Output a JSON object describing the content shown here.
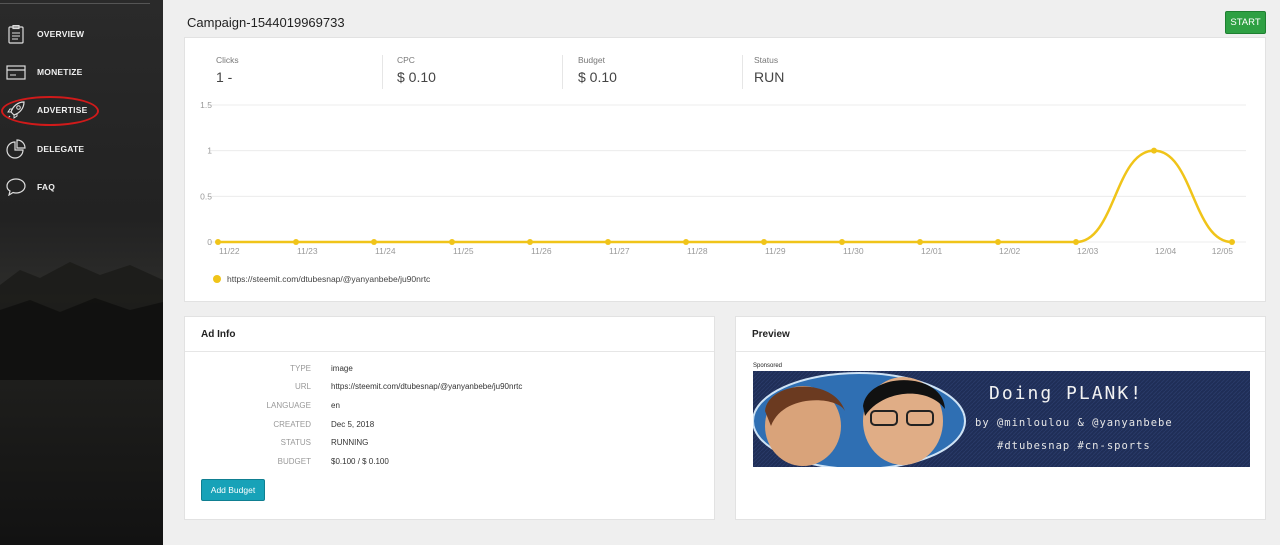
{
  "sidebar": {
    "items": [
      {
        "label": "OVERVIEW",
        "icon": "clipboard-icon"
      },
      {
        "label": "MONETIZE",
        "icon": "card-icon"
      },
      {
        "label": "ADVERTISE",
        "icon": "rocket-icon"
      },
      {
        "label": "DELEGATE",
        "icon": "pie-chart-icon"
      },
      {
        "label": "FAQ",
        "icon": "chat-bubble-icon"
      }
    ],
    "highlight_color": "#d01a1a"
  },
  "header": {
    "title": "Campaign-1544019969733",
    "start_label": "START"
  },
  "stats": {
    "clicks_label": "Clicks",
    "clicks_value": "1 -",
    "cpc_label": "CPC",
    "cpc_value": "$ 0.10",
    "budget_label": "Budget",
    "budget_value": "$ 0.10",
    "status_label": "Status",
    "status_value": "RUN"
  },
  "chart_data": {
    "type": "line",
    "x": [
      "11/22",
      "11/23",
      "11/24",
      "11/25",
      "11/26",
      "11/27",
      "11/28",
      "11/29",
      "11/30",
      "12/01",
      "12/02",
      "12/03",
      "12/04",
      "12/05"
    ],
    "series": [
      {
        "name": "https://steemit.com/dtubesnap/@yanyanbebe/ju90nrtc",
        "values": [
          0,
          0,
          0,
          0,
          0,
          0,
          0,
          0,
          0,
          0,
          0,
          0,
          1,
          0
        ],
        "color": "#f0c419"
      }
    ],
    "y_ticks": [
      "0",
      "0.5",
      "1",
      "1.5"
    ],
    "ylim": [
      0,
      1.5
    ],
    "grid": true,
    "legend_position": "bottom-left"
  },
  "adinfo": {
    "title": "Ad Info",
    "rows": [
      {
        "key": "TYPE",
        "value": "image"
      },
      {
        "key": "URL",
        "value": "https://steemit.com/dtubesnap/@yanyanbebe/ju90nrtc"
      },
      {
        "key": "LANGUAGE",
        "value": "en"
      },
      {
        "key": "CREATED",
        "value": "Dec 5, 2018"
      },
      {
        "key": "STATUS",
        "value": "RUNNING"
      },
      {
        "key": "BUDGET",
        "value": "$0.100 / $ 0.100"
      }
    ],
    "add_budget_label": "Add Budget"
  },
  "preview": {
    "title": "Preview",
    "sponsored_label": "Sponsored",
    "banner": {
      "line1": "Doing PLANK!",
      "line2": "by @minloulou & @yanyanbebe",
      "line3": "#dtubesnap   #cn-sports"
    }
  }
}
